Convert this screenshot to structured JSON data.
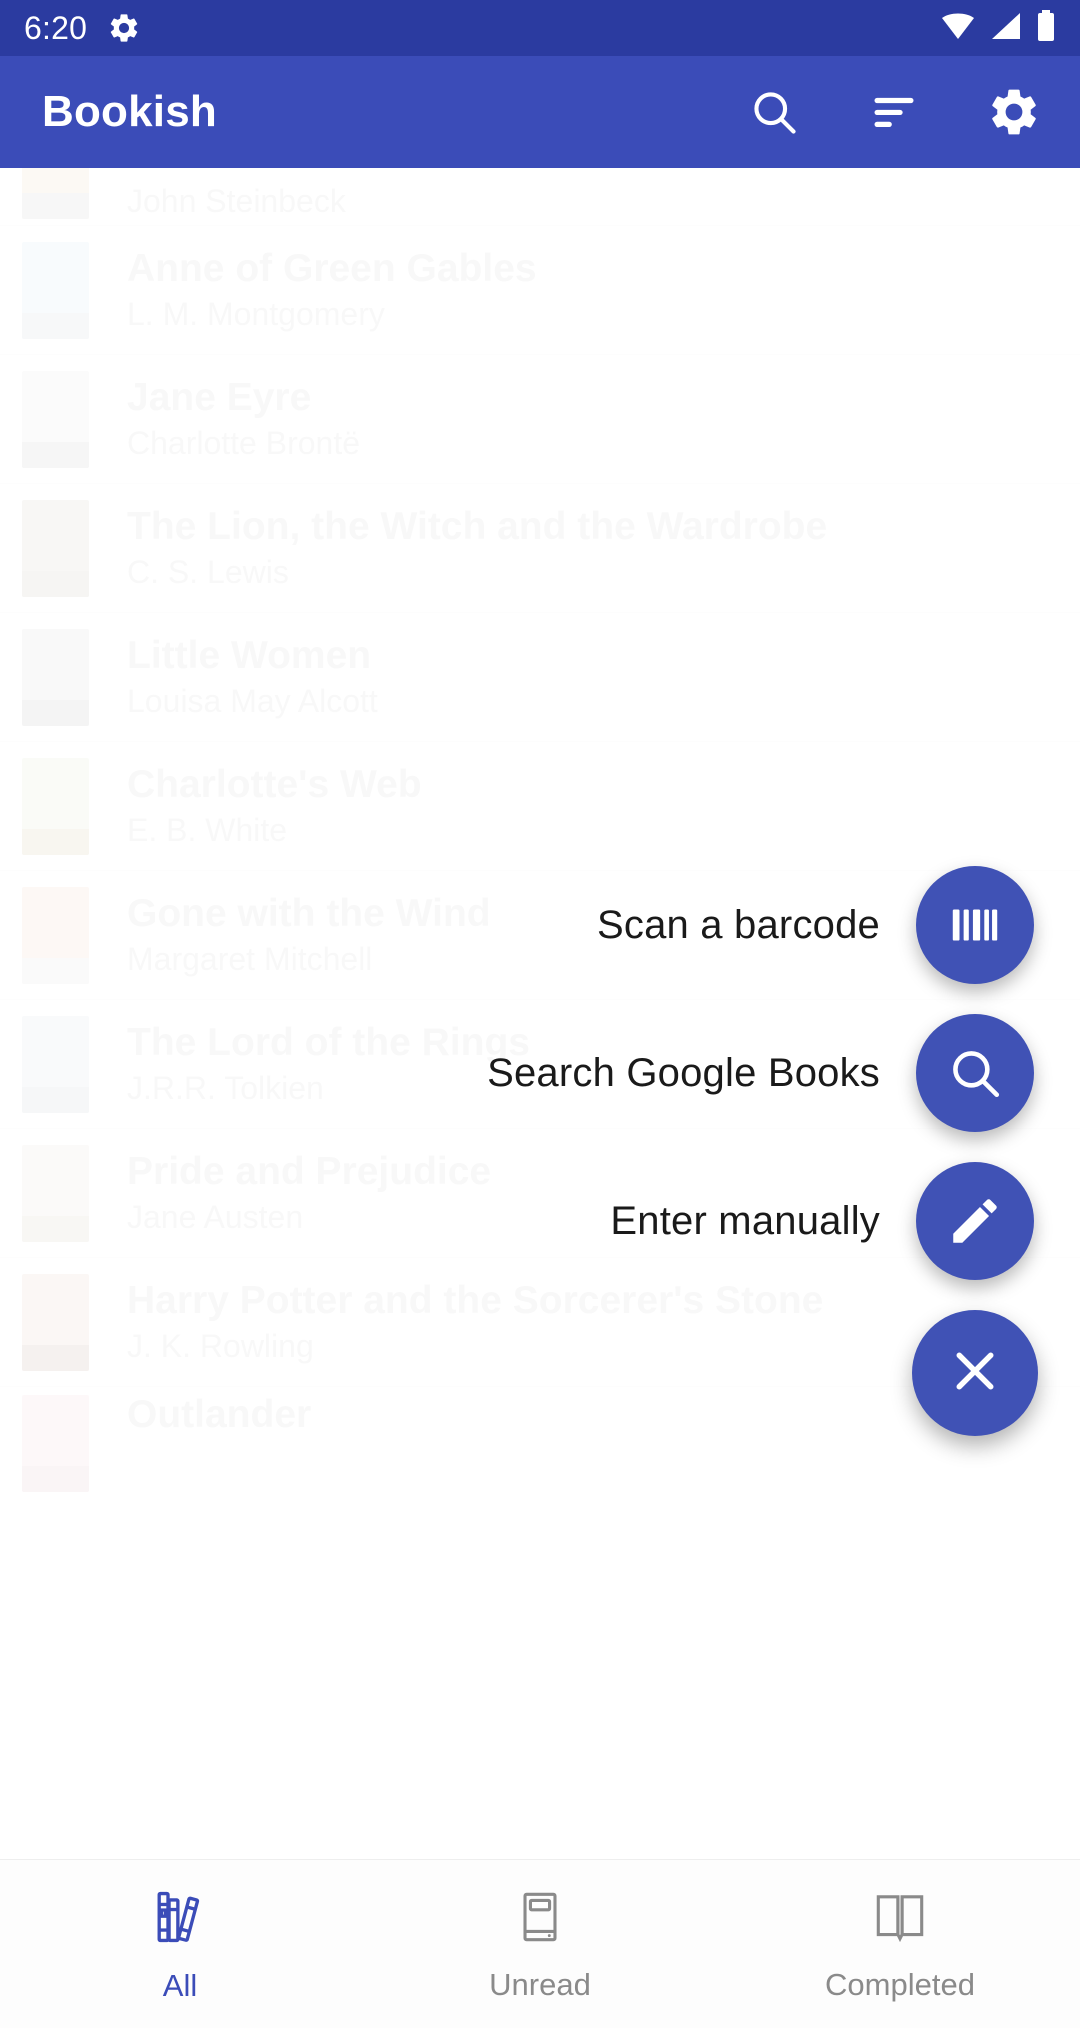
{
  "status_bar": {
    "time": "6:20",
    "icons": [
      "gear-icon",
      "wifi-icon",
      "cellular-signal-icon",
      "battery-icon"
    ]
  },
  "app_bar": {
    "title": "Bookish",
    "actions": [
      {
        "name": "search-icon",
        "label": "Search"
      },
      {
        "name": "sort-icon",
        "label": "Sort"
      },
      {
        "name": "settings-gear-icon",
        "label": "Settings"
      }
    ]
  },
  "colors": {
    "status_bar": "#2b3ba0",
    "app_bar": "#3b4cb8",
    "fab": "#4052b5",
    "accent": "#3b4cb8",
    "dimmed_text": "#d9d9d9",
    "nav_inactive": "#8a8a8a"
  },
  "book_list": [
    {
      "title": "",
      "author": "John Steinbeck",
      "cover_top": "#efe2c8",
      "cover_bottom": "#d8d8d8",
      "partial": true
    },
    {
      "title": "Anne of Green Gables",
      "author": "L. M. Montgomery",
      "cover_top": "#dbe8f2",
      "cover_bottom": "#d5dce2"
    },
    {
      "title": "Jane Eyre",
      "author": "Charlotte Brontë",
      "cover_top": "#e8e8e8",
      "cover_bottom": "#d2d2d2"
    },
    {
      "title": "The Lion, the Witch and the Wardrobe",
      "author": "C. S. Lewis",
      "cover_top": "#d9d4cd",
      "cover_bottom": "#cfcbc4"
    },
    {
      "title": "Little Women",
      "author": "Louisa May Alcott",
      "cover_top": "#dedede",
      "cover_bottom": "#c9c9c9"
    },
    {
      "title": "Charlotte's Web",
      "author": "E. B. White",
      "cover_top": "#e7ecd8",
      "cover_bottom": "#ddd0b6"
    },
    {
      "title": "Gone with the Wind",
      "author": "Margaret Mitchell",
      "cover_top": "#f4d9cb",
      "cover_bottom": "#e3e3e3"
    },
    {
      "title": "The Lord of the Rings",
      "author": "J.R.R. Tolkien",
      "cover_top": "#dfe4e8",
      "cover_bottom": "#d3d8dc"
    },
    {
      "title": "Pride and Prejudice",
      "author": "Jane Austen",
      "cover_top": "#ece7de",
      "cover_bottom": "#ddd6c9"
    },
    {
      "title": "Harry Potter and the Sorcerer's Stone",
      "author": "J. K. Rowling",
      "cover_top": "#e9d6cd",
      "cover_bottom": "#cdb9ae"
    },
    {
      "title": "Outlander",
      "author": "",
      "cover_top": "#f3dde2",
      "cover_bottom": "#e6ccd3",
      "partial": true
    }
  ],
  "speed_dial": {
    "expanded": true,
    "items": [
      {
        "label": "Scan a barcode",
        "icon": "barcode-icon"
      },
      {
        "label": "Search Google Books",
        "icon": "search-icon"
      },
      {
        "label": "Enter manually",
        "icon": "pencil-edit-icon"
      }
    ],
    "close_button": {
      "icon": "close-x-icon",
      "label": "Close"
    }
  },
  "bottom_nav": {
    "active_index": 0,
    "items": [
      {
        "label": "All",
        "icon": "books-stack-icon"
      },
      {
        "label": "Unread",
        "icon": "closed-book-icon"
      },
      {
        "label": "Completed",
        "icon": "open-book-icon"
      }
    ]
  }
}
